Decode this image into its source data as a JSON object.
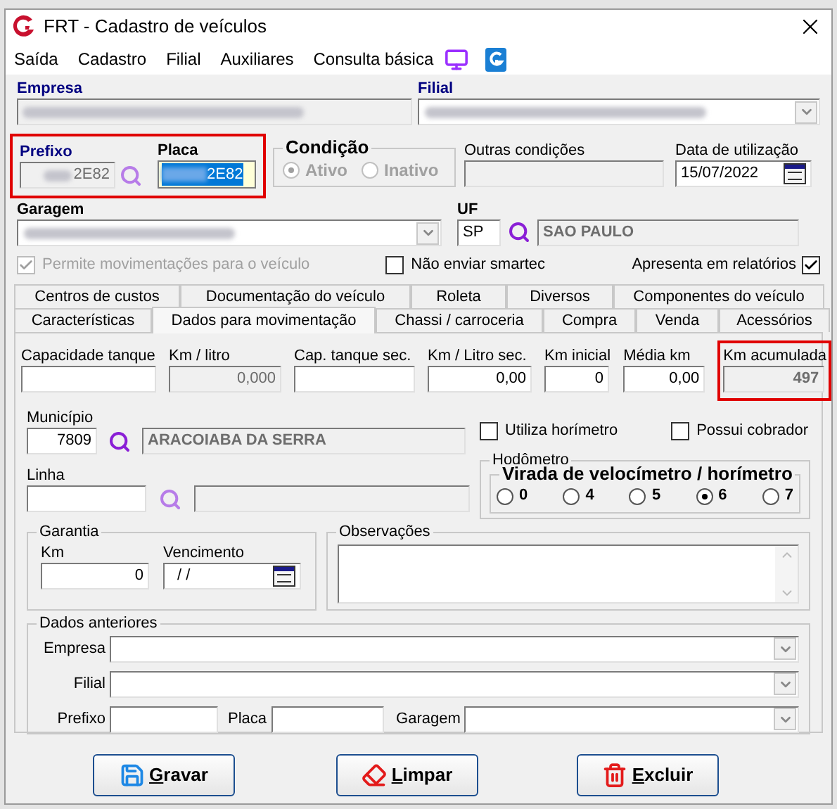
{
  "window": {
    "title": "FRT - Cadastro de veículos"
  },
  "menu": [
    "Saída",
    "Cadastro",
    "Filial",
    "Auxiliares",
    "Consulta básica"
  ],
  "empresa": {
    "label": "Empresa",
    "redacted": true
  },
  "filial": {
    "label": "Filial",
    "redacted": true
  },
  "identificacao": {
    "highlighted": true,
    "prefixo": {
      "label": "Prefixo",
      "value": "2E82",
      "redacted": true
    },
    "placa": {
      "label": "Placa",
      "value": "2E82",
      "redacted": true,
      "selected": true
    }
  },
  "condicao": {
    "label": "Condição",
    "disabled": true,
    "options": [
      {
        "label": "Ativo",
        "selected": true
      },
      {
        "label": "Inativo",
        "selected": false
      }
    ]
  },
  "outras_condicoes": {
    "label": "Outras condições",
    "disabled": true
  },
  "data_utilizacao": {
    "label": "Data de utilização",
    "value": "15/07/2022"
  },
  "garagem": {
    "label": "Garagem",
    "redacted": true
  },
  "uf": {
    "label": "UF",
    "value": "SP",
    "name": "SAO PAULO"
  },
  "checks": [
    {
      "kind": "box-left",
      "label": "Permite movimentações para o veículo",
      "checked": true,
      "disabled": true
    },
    {
      "kind": "box-left",
      "label": "Não enviar smartec",
      "checked": false,
      "disabled": false
    },
    {
      "kind": "box-right",
      "label": "Apresenta em relatórios",
      "checked": true,
      "disabled": false
    }
  ],
  "tabs": [
    [
      {
        "label": "Centros de custos",
        "selected": false
      },
      {
        "label": "Documentação do veículo",
        "selected": false
      },
      {
        "label": "Roleta",
        "selected": false
      },
      {
        "label": "Diversos",
        "selected": false
      },
      {
        "label": "Componentes do veículo",
        "selected": false
      }
    ],
    [
      {
        "label": "Características",
        "selected": false
      },
      {
        "label": "Dados para movimentação",
        "selected": true
      },
      {
        "label": "Chassi / carroceria",
        "selected": false
      },
      {
        "label": "Compra",
        "selected": false
      },
      {
        "label": "Venda",
        "selected": false
      },
      {
        "label": "Acessórios",
        "selected": false
      }
    ]
  ],
  "fields": [
    {
      "label": "Capacidade tanque",
      "disabled": false,
      "highlighted": false
    },
    {
      "label": "Km / litro",
      "value": "0,000",
      "disabled": true,
      "highlighted": false
    },
    {
      "label": "Cap. tanque sec.",
      "disabled": false,
      "highlighted": false
    },
    {
      "label": "Km / Litro sec.",
      "value": "0,00",
      "disabled": false,
      "highlighted": false
    },
    {
      "label": "Km inicial",
      "value": "0",
      "disabled": false,
      "highlighted": false
    },
    {
      "label": "Média km",
      "value": "0,00",
      "disabled": false,
      "highlighted": false
    },
    {
      "label": "Km acumulada",
      "value": "497",
      "disabled": true,
      "highlighted": true
    }
  ],
  "municipio": {
    "label": "Município",
    "value": "7809",
    "name": "ARACOIABA DA SERRA"
  },
  "linha": {
    "label": "Linha"
  },
  "options": [
    {
      "label": "Utiliza horímetro",
      "checked": false
    },
    {
      "label": "Possui cobrador",
      "checked": false
    }
  ],
  "hodometro": {
    "label": "Hodômetro",
    "inner_label": "Virada de velocímetro / horímetro",
    "options": [
      {
        "label": "0",
        "selected": false
      },
      {
        "label": "4",
        "selected": false
      },
      {
        "label": "5",
        "selected": false
      },
      {
        "label": "6",
        "selected": true
      },
      {
        "label": "7",
        "selected": false
      }
    ]
  },
  "garantia": {
    "label": "Garantia",
    "km_label": "Km",
    "km_value": "0",
    "vencimento_label": "Vencimento",
    "vencimento_value": "/ /"
  },
  "observacoes": {
    "label": "Observações"
  },
  "dados_anteriores": {
    "label": "Dados anteriores",
    "empresa": "Empresa",
    "filial": "Filial",
    "prefixo": "Prefixo",
    "placa": "Placa",
    "garagem": "Garagem"
  },
  "buttons": [
    {
      "kind": "save",
      "label": "Gravar"
    },
    {
      "kind": "clear",
      "label": "Limpar"
    },
    {
      "kind": "delete",
      "label": "Excluir"
    }
  ]
}
